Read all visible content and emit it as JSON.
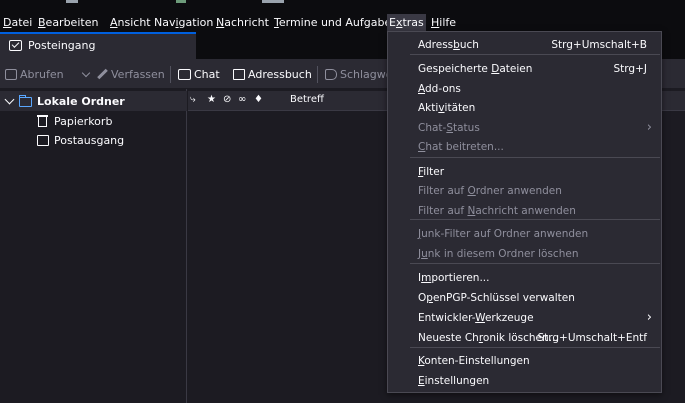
{
  "menubar": {
    "items": [
      {
        "text": "Datei",
        "u": "D"
      },
      {
        "text": "Bearbeiten",
        "u": "B"
      },
      {
        "text": "Ansicht",
        "u": "A"
      },
      {
        "text": "Navigation",
        "u": "i"
      },
      {
        "text": "Nachricht",
        "u": "N"
      },
      {
        "text": "Termine und Aufgaben",
        "u": "T"
      },
      {
        "text": "Extras",
        "u": "x"
      },
      {
        "text": "Hilfe",
        "u": "H"
      }
    ]
  },
  "tab": {
    "label": "Posteingang",
    "icon": "inbox-icon"
  },
  "toolbar": {
    "abrufen": "Abrufen",
    "verfassen": "Verfassen",
    "chat": "Chat",
    "adressbuch": "Adressbuch",
    "schlagwoerter": "Schlagwör"
  },
  "folders": {
    "account": "Lokale Ordner",
    "items": [
      "Papierkorb",
      "Postausgang"
    ]
  },
  "msglist": {
    "subject_header": "Betreff"
  },
  "extras_menu": {
    "items": [
      {
        "label": "Adressbuch",
        "u": "b",
        "shortcut": "Strg+Umschalt+B",
        "disabled": false,
        "submenu": false
      },
      {
        "label": "Gespeicherte Dateien",
        "u": "D",
        "shortcut": "Strg+J",
        "disabled": false,
        "submenu": false
      },
      {
        "label": "Add-ons",
        "u": "A",
        "shortcut": "",
        "disabled": false,
        "submenu": false
      },
      {
        "label": "Aktivitäten",
        "u": "v",
        "shortcut": "",
        "disabled": false,
        "submenu": false
      },
      {
        "label": "Chat-Status",
        "u": "S",
        "shortcut": "",
        "disabled": true,
        "submenu": true
      },
      {
        "label": "Chat beitreten...",
        "u": "C",
        "shortcut": "",
        "disabled": true,
        "submenu": false
      },
      {
        "label": "Filter",
        "u": "F",
        "shortcut": "",
        "disabled": false,
        "submenu": false
      },
      {
        "label": "Filter auf Ordner anwenden",
        "u": "O",
        "shortcut": "",
        "disabled": true,
        "submenu": false
      },
      {
        "label": "Filter auf Nachricht anwenden",
        "u": "N",
        "shortcut": "",
        "disabled": true,
        "submenu": false
      },
      {
        "label": "Junk-Filter auf Ordner anwenden",
        "u": "J",
        "shortcut": "",
        "disabled": true,
        "submenu": false
      },
      {
        "label": "Junk in diesem Ordner löschen",
        "u": "u",
        "shortcut": "",
        "disabled": true,
        "submenu": false
      },
      {
        "label": "Importieren...",
        "u": "m",
        "shortcut": "",
        "disabled": false,
        "submenu": false
      },
      {
        "label": "OpenPGP-Schlüssel verwalten",
        "u": "p",
        "shortcut": "",
        "disabled": false,
        "submenu": false
      },
      {
        "label": "Entwickler-Werkzeuge",
        "u": "W",
        "shortcut": "",
        "disabled": false,
        "submenu": true
      },
      {
        "label": "Neueste Chronik löschen...",
        "u": "r",
        "shortcut": "Strg+Umschalt+Entf",
        "disabled": false,
        "submenu": false
      },
      {
        "label": "Konten-Einstellungen",
        "u": "K",
        "shortcut": "",
        "disabled": false,
        "submenu": false
      },
      {
        "label": "Einstellungen",
        "u": "E",
        "shortcut": "",
        "disabled": false,
        "submenu": false
      }
    ]
  },
  "colors": {
    "accent": "#0060df",
    "folder": "#5aa7ff",
    "menu_bg": "#2b2a33",
    "app_bg": "#1c1b22"
  }
}
